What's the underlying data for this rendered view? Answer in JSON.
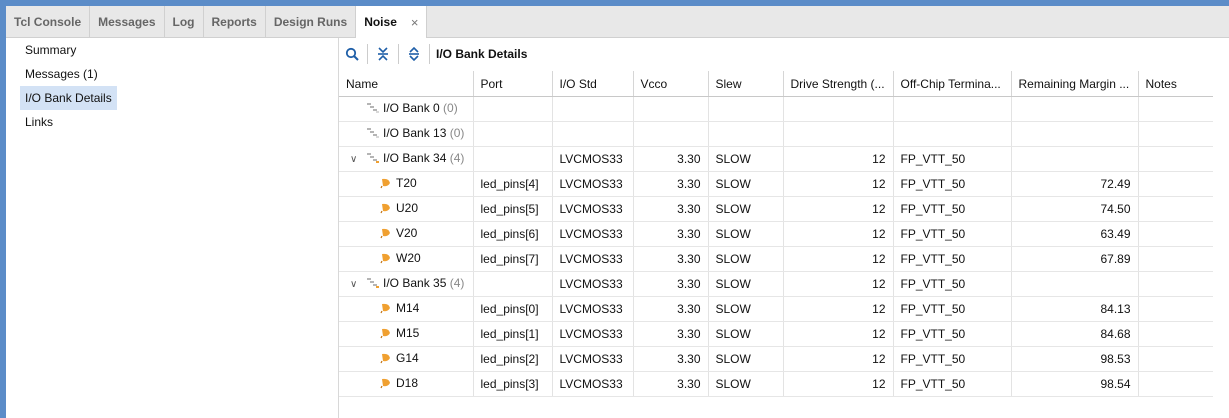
{
  "tabs": [
    {
      "label": "Tcl Console",
      "active": false
    },
    {
      "label": "Messages",
      "active": false
    },
    {
      "label": "Log",
      "active": false
    },
    {
      "label": "Reports",
      "active": false
    },
    {
      "label": "Design Runs",
      "active": false
    },
    {
      "label": "Noise",
      "active": true,
      "close": "×"
    }
  ],
  "sidebar": {
    "items": [
      {
        "label": "Summary",
        "selected": false
      },
      {
        "label": "Messages (1)",
        "selected": false
      },
      {
        "label": "I/O Bank Details",
        "selected": true
      },
      {
        "label": "Links",
        "selected": false
      }
    ]
  },
  "toolbar": {
    "title": "I/O Bank Details",
    "icons": [
      "search-icon",
      "collapse-all-icon",
      "expand-all-icon"
    ]
  },
  "colors": {
    "accent": "#5b8cc8",
    "selection": "#d3e2f5",
    "pin_icon": "#f0a030",
    "bank_icon": "#b0b0b0"
  },
  "table": {
    "headers": [
      "Name",
      "Port",
      "I/O Std",
      "Vcco",
      "Slew",
      "Drive Strength (...",
      "Off-Chip Termina...",
      "Remaining Margin ...",
      "Notes"
    ],
    "rows": [
      {
        "kind": "bank",
        "expanded": null,
        "name": "I/O Bank 0",
        "count": "(0)",
        "port": "",
        "iostd": "",
        "vcco": "",
        "slew": "",
        "drive": "",
        "term": "",
        "margin": "",
        "notes": ""
      },
      {
        "kind": "bank",
        "expanded": null,
        "name": "I/O Bank 13",
        "count": "(0)",
        "port": "",
        "iostd": "",
        "vcco": "",
        "slew": "",
        "drive": "",
        "term": "",
        "margin": "",
        "notes": ""
      },
      {
        "kind": "bank",
        "expanded": true,
        "name": "I/O Bank 34",
        "count": "(4)",
        "port": "",
        "iostd": "LVCMOS33",
        "vcco": "3.30",
        "slew": "SLOW",
        "drive": "12",
        "term": "FP_VTT_50",
        "margin": "",
        "notes": ""
      },
      {
        "kind": "pin",
        "name": "T20",
        "count": "",
        "port": "led_pins[4]",
        "iostd": "LVCMOS33",
        "vcco": "3.30",
        "slew": "SLOW",
        "drive": "12",
        "term": "FP_VTT_50",
        "margin": "72.49",
        "notes": ""
      },
      {
        "kind": "pin",
        "name": "U20",
        "count": "",
        "port": "led_pins[5]",
        "iostd": "LVCMOS33",
        "vcco": "3.30",
        "slew": "SLOW",
        "drive": "12",
        "term": "FP_VTT_50",
        "margin": "74.50",
        "notes": ""
      },
      {
        "kind": "pin",
        "name": "V20",
        "count": "",
        "port": "led_pins[6]",
        "iostd": "LVCMOS33",
        "vcco": "3.30",
        "slew": "SLOW",
        "drive": "12",
        "term": "FP_VTT_50",
        "margin": "63.49",
        "notes": ""
      },
      {
        "kind": "pin",
        "name": "W20",
        "count": "",
        "port": "led_pins[7]",
        "iostd": "LVCMOS33",
        "vcco": "3.30",
        "slew": "SLOW",
        "drive": "12",
        "term": "FP_VTT_50",
        "margin": "67.89",
        "notes": ""
      },
      {
        "kind": "bank",
        "expanded": true,
        "name": "I/O Bank 35",
        "count": "(4)",
        "port": "",
        "iostd": "LVCMOS33",
        "vcco": "3.30",
        "slew": "SLOW",
        "drive": "12",
        "term": "FP_VTT_50",
        "margin": "",
        "notes": ""
      },
      {
        "kind": "pin",
        "name": "M14",
        "count": "",
        "port": "led_pins[0]",
        "iostd": "LVCMOS33",
        "vcco": "3.30",
        "slew": "SLOW",
        "drive": "12",
        "term": "FP_VTT_50",
        "margin": "84.13",
        "notes": ""
      },
      {
        "kind": "pin",
        "name": "M15",
        "count": "",
        "port": "led_pins[1]",
        "iostd": "LVCMOS33",
        "vcco": "3.30",
        "slew": "SLOW",
        "drive": "12",
        "term": "FP_VTT_50",
        "margin": "84.68",
        "notes": ""
      },
      {
        "kind": "pin",
        "name": "G14",
        "count": "",
        "port": "led_pins[2]",
        "iostd": "LVCMOS33",
        "vcco": "3.30",
        "slew": "SLOW",
        "drive": "12",
        "term": "FP_VTT_50",
        "margin": "98.53",
        "notes": ""
      },
      {
        "kind": "pin",
        "name": "D18",
        "count": "",
        "port": "led_pins[3]",
        "iostd": "LVCMOS33",
        "vcco": "3.30",
        "slew": "SLOW",
        "drive": "12",
        "term": "FP_VTT_50",
        "margin": "98.54",
        "notes": ""
      }
    ]
  }
}
